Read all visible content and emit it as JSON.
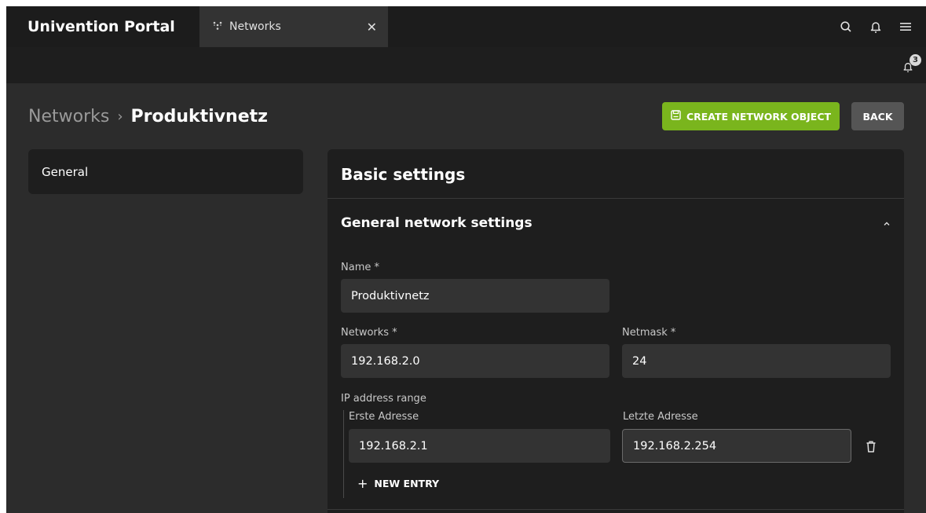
{
  "header": {
    "portal_title": "Univention Portal",
    "tab_label": "Networks",
    "tab_icon": "network-icon",
    "close_symbol": "✕"
  },
  "notifications": {
    "count": "3"
  },
  "breadcrumb": {
    "root": "Networks",
    "separator": "›",
    "current": "Produktivnetz"
  },
  "actions": {
    "create_label": "CREATE NETWORK OBJECT",
    "back_label": "BACK"
  },
  "sidebar": {
    "items": [
      {
        "label": "General"
      }
    ]
  },
  "panel": {
    "title": "Basic settings",
    "section_title": "General network settings",
    "fields": {
      "name_label": "Name *",
      "name_value": "Produktivnetz",
      "networks_label": "Networks *",
      "networks_value": "192.168.2.0",
      "netmask_label": "Netmask *",
      "netmask_value": "24",
      "ip_range_label": "IP address range",
      "first_label": "Erste Adresse",
      "first_value": "192.168.2.1",
      "last_label": "Letzte Adresse",
      "last_value": "192.168.2.254"
    },
    "new_entry_label": "NEW ENTRY",
    "new_entry_symbol": "+"
  },
  "colors": {
    "accent": "#7ab51d",
    "background": "#2c2c2c",
    "card": "#1e1e1e",
    "input": "#333333"
  }
}
